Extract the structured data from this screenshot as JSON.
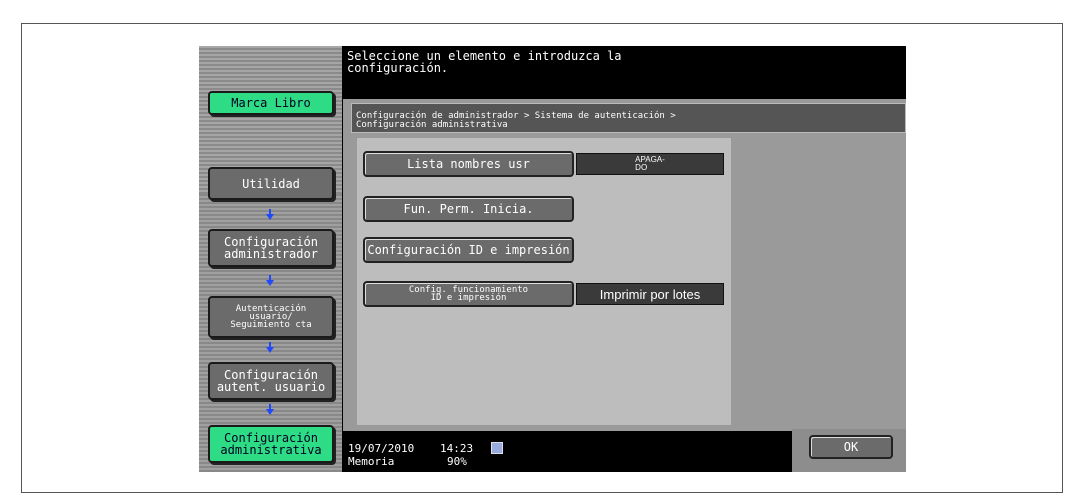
{
  "message": "Seleccione un elemento e introduzca la\nconfiguración.",
  "sidebar": {
    "bookmark": "Marca Libro",
    "items": [
      {
        "label": "Utilidad"
      },
      {
        "label": "Configuración\nadministrador"
      },
      {
        "label": "Autenticación\nusuario/\nSeguimiento cta"
      },
      {
        "label": "Configuración\nautent. usuario"
      },
      {
        "label": "Configuración\nadministrativa"
      }
    ]
  },
  "breadcrumb": "Configuración de administrador > Sistema de autenticación >\nConfiguración administrativa",
  "settings": {
    "user_list_label": "Lista nombres usr",
    "user_list_value": "APAGA-\nDO",
    "func_perm_label": "Fun. Perm. Inicia.",
    "id_print_label": "Configuración ID e impresión",
    "id_print_op_label": "Config. funcionamiento\nID e impresión",
    "id_print_op_value": "Imprimir por lotes"
  },
  "status": {
    "date": "19/07/2010",
    "time": "14:23",
    "memory_label": "Memoria",
    "memory_value": "90%"
  },
  "ok_label": "OK",
  "colors": {
    "active": "#2fdc86",
    "arrow": "#1e49ff"
  },
  "icons": [
    "down-arrow-icon",
    "memory-icon"
  ]
}
